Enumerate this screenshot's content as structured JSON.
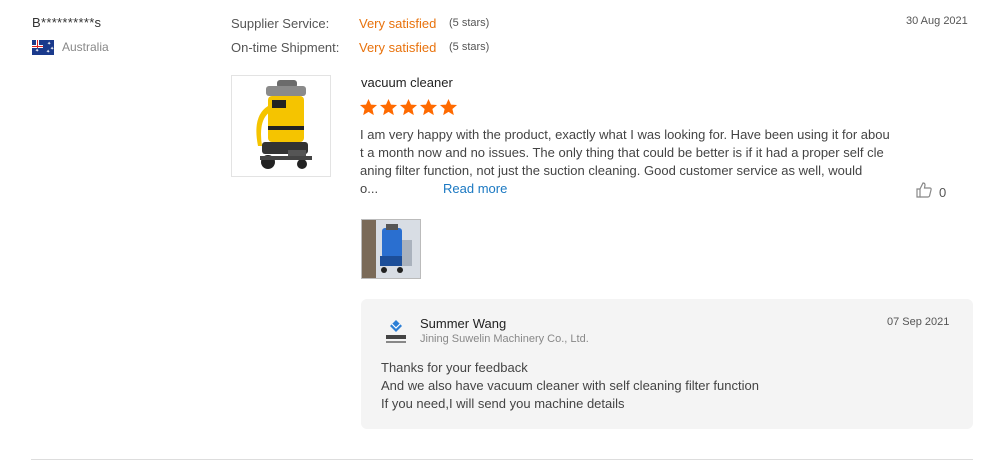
{
  "review": {
    "reviewer_name": "B**********s",
    "country": "Australia",
    "date": "30 Aug 2021",
    "ratings": [
      {
        "label": "Supplier Service:",
        "value": "Very satisfied",
        "stars_text": "(5 stars)"
      },
      {
        "label": "On-time Shipment:",
        "value": "Very satisfied",
        "stars_text": "(5 stars)"
      }
    ],
    "product_title": "vacuum cleaner",
    "star_rating": 5,
    "star_color": "#ff6a00",
    "text_lines": [
      "I am very happy with the product, exactly what I was looking for. Have been using it for abou",
      "t a month now and no issues. The only thing that could be better is if it had a proper self cle",
      "aning filter function, not just the suction cleaning. Good customer service as well, would",
      "o..."
    ],
    "read_more": "Read more",
    "like_count": "0"
  },
  "reply": {
    "name": "Summer Wang",
    "company": "Jining Suwelin Machinery Co., Ltd.",
    "date": "07 Sep 2021",
    "lines": [
      "Thanks for your feedback",
      "And we also have vacuum cleaner with  self cleaning filter function",
      "If you need,I will send you machine details"
    ]
  },
  "icons": {
    "flag": "australia-flag-icon",
    "like": "thumbs-up-icon",
    "star": "star-icon",
    "logo": "company-logo-icon"
  }
}
